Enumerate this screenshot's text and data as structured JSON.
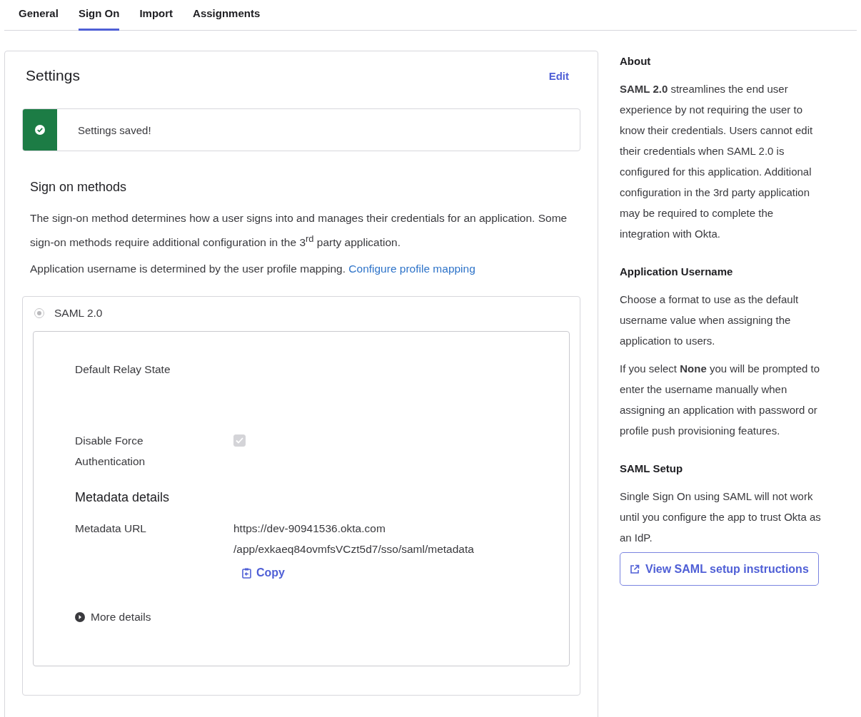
{
  "tabs": [
    {
      "label": "General",
      "selected": false
    },
    {
      "label": "Sign On",
      "selected": true
    },
    {
      "label": "Import",
      "selected": false
    },
    {
      "label": "Assignments",
      "selected": false
    }
  ],
  "settings": {
    "title": "Settings",
    "edit": "Edit",
    "alert": {
      "kind": "success",
      "text": "Settings saved!"
    },
    "section_title": "Sign on methods",
    "description": "The sign-on method determines how a user signs into and manages their credentials for an application. Some sign-on methods require additional configuration in the 3$^{rd}$ party application.",
    "username_note": "Application username is determined by the user profile mapping.",
    "username_link": "Configure profile mapping",
    "method": {
      "label": "SAML 2.0",
      "selected": true,
      "disabled": true
    },
    "fields": [
      {
        "kind": "text",
        "label": "Default Relay State"
      },
      {
        "kind": "checkbox",
        "label": "Disable Force Authentication",
        "checked": true,
        "disabled": true
      }
    ],
    "metadata": {
      "title": "Metadata details",
      "label": "Metadata URL",
      "url_lines": [
        "https://dev-90941536.okta.com",
        "/app/exkaeq84ovmfsVCzt5d7/sso/saml/metadata"
      ],
      "copy": "Copy",
      "more": "More details"
    }
  },
  "sidebar": [
    {
      "title": "About",
      "paragraphs": [
        "**SAML 2.0** streamlines the end user experience by not requiring the user to know their credentials. Users cannot edit their credentials when SAML 2.0 is configured for this application. Additional configuration in the 3rd party application may be required to complete the integration with Okta."
      ]
    },
    {
      "title": "Application Username",
      "paragraphs": [
        "Choose a format to use as the default username value when assigning the application to users.",
        "If you select **None** you will be prompted to enter the username manually when assigning an application with password or profile push provisioning features."
      ]
    },
    {
      "title": "SAML Setup",
      "paragraphs": [
        "Single Sign On using SAML will not work until you configure the app to trust Okta as an IdP."
      ],
      "button": "View SAML setup instructions"
    }
  ]
}
